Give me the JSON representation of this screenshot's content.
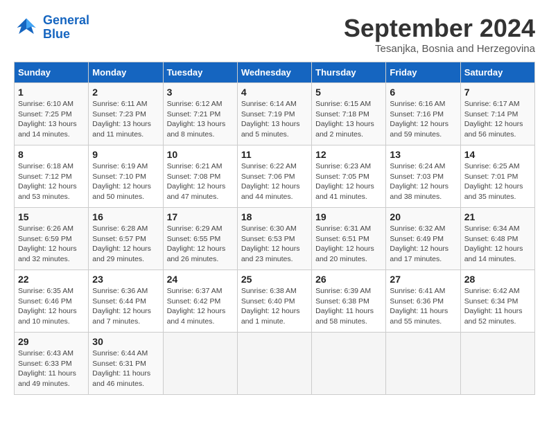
{
  "logo": {
    "line1": "General",
    "line2": "Blue"
  },
  "title": "September 2024",
  "subtitle": "Tesanjka, Bosnia and Herzegovina",
  "days_of_week": [
    "Sunday",
    "Monday",
    "Tuesday",
    "Wednesday",
    "Thursday",
    "Friday",
    "Saturday"
  ],
  "weeks": [
    [
      {
        "day": "1",
        "info": "Sunrise: 6:10 AM\nSunset: 7:25 PM\nDaylight: 13 hours\nand 14 minutes."
      },
      {
        "day": "2",
        "info": "Sunrise: 6:11 AM\nSunset: 7:23 PM\nDaylight: 13 hours\nand 11 minutes."
      },
      {
        "day": "3",
        "info": "Sunrise: 6:12 AM\nSunset: 7:21 PM\nDaylight: 13 hours\nand 8 minutes."
      },
      {
        "day": "4",
        "info": "Sunrise: 6:14 AM\nSunset: 7:19 PM\nDaylight: 13 hours\nand 5 minutes."
      },
      {
        "day": "5",
        "info": "Sunrise: 6:15 AM\nSunset: 7:18 PM\nDaylight: 13 hours\nand 2 minutes."
      },
      {
        "day": "6",
        "info": "Sunrise: 6:16 AM\nSunset: 7:16 PM\nDaylight: 12 hours\nand 59 minutes."
      },
      {
        "day": "7",
        "info": "Sunrise: 6:17 AM\nSunset: 7:14 PM\nDaylight: 12 hours\nand 56 minutes."
      }
    ],
    [
      {
        "day": "8",
        "info": "Sunrise: 6:18 AM\nSunset: 7:12 PM\nDaylight: 12 hours\nand 53 minutes."
      },
      {
        "day": "9",
        "info": "Sunrise: 6:19 AM\nSunset: 7:10 PM\nDaylight: 12 hours\nand 50 minutes."
      },
      {
        "day": "10",
        "info": "Sunrise: 6:21 AM\nSunset: 7:08 PM\nDaylight: 12 hours\nand 47 minutes."
      },
      {
        "day": "11",
        "info": "Sunrise: 6:22 AM\nSunset: 7:06 PM\nDaylight: 12 hours\nand 44 minutes."
      },
      {
        "day": "12",
        "info": "Sunrise: 6:23 AM\nSunset: 7:05 PM\nDaylight: 12 hours\nand 41 minutes."
      },
      {
        "day": "13",
        "info": "Sunrise: 6:24 AM\nSunset: 7:03 PM\nDaylight: 12 hours\nand 38 minutes."
      },
      {
        "day": "14",
        "info": "Sunrise: 6:25 AM\nSunset: 7:01 PM\nDaylight: 12 hours\nand 35 minutes."
      }
    ],
    [
      {
        "day": "15",
        "info": "Sunrise: 6:26 AM\nSunset: 6:59 PM\nDaylight: 12 hours\nand 32 minutes."
      },
      {
        "day": "16",
        "info": "Sunrise: 6:28 AM\nSunset: 6:57 PM\nDaylight: 12 hours\nand 29 minutes."
      },
      {
        "day": "17",
        "info": "Sunrise: 6:29 AM\nSunset: 6:55 PM\nDaylight: 12 hours\nand 26 minutes."
      },
      {
        "day": "18",
        "info": "Sunrise: 6:30 AM\nSunset: 6:53 PM\nDaylight: 12 hours\nand 23 minutes."
      },
      {
        "day": "19",
        "info": "Sunrise: 6:31 AM\nSunset: 6:51 PM\nDaylight: 12 hours\nand 20 minutes."
      },
      {
        "day": "20",
        "info": "Sunrise: 6:32 AM\nSunset: 6:49 PM\nDaylight: 12 hours\nand 17 minutes."
      },
      {
        "day": "21",
        "info": "Sunrise: 6:34 AM\nSunset: 6:48 PM\nDaylight: 12 hours\nand 14 minutes."
      }
    ],
    [
      {
        "day": "22",
        "info": "Sunrise: 6:35 AM\nSunset: 6:46 PM\nDaylight: 12 hours\nand 10 minutes."
      },
      {
        "day": "23",
        "info": "Sunrise: 6:36 AM\nSunset: 6:44 PM\nDaylight: 12 hours\nand 7 minutes."
      },
      {
        "day": "24",
        "info": "Sunrise: 6:37 AM\nSunset: 6:42 PM\nDaylight: 12 hours\nand 4 minutes."
      },
      {
        "day": "25",
        "info": "Sunrise: 6:38 AM\nSunset: 6:40 PM\nDaylight: 12 hours\nand 1 minute."
      },
      {
        "day": "26",
        "info": "Sunrise: 6:39 AM\nSunset: 6:38 PM\nDaylight: 11 hours\nand 58 minutes."
      },
      {
        "day": "27",
        "info": "Sunrise: 6:41 AM\nSunset: 6:36 PM\nDaylight: 11 hours\nand 55 minutes."
      },
      {
        "day": "28",
        "info": "Sunrise: 6:42 AM\nSunset: 6:34 PM\nDaylight: 11 hours\nand 52 minutes."
      }
    ],
    [
      {
        "day": "29",
        "info": "Sunrise: 6:43 AM\nSunset: 6:33 PM\nDaylight: 11 hours\nand 49 minutes."
      },
      {
        "day": "30",
        "info": "Sunrise: 6:44 AM\nSunset: 6:31 PM\nDaylight: 11 hours\nand 46 minutes."
      },
      {
        "day": "",
        "info": ""
      },
      {
        "day": "",
        "info": ""
      },
      {
        "day": "",
        "info": ""
      },
      {
        "day": "",
        "info": ""
      },
      {
        "day": "",
        "info": ""
      }
    ]
  ]
}
